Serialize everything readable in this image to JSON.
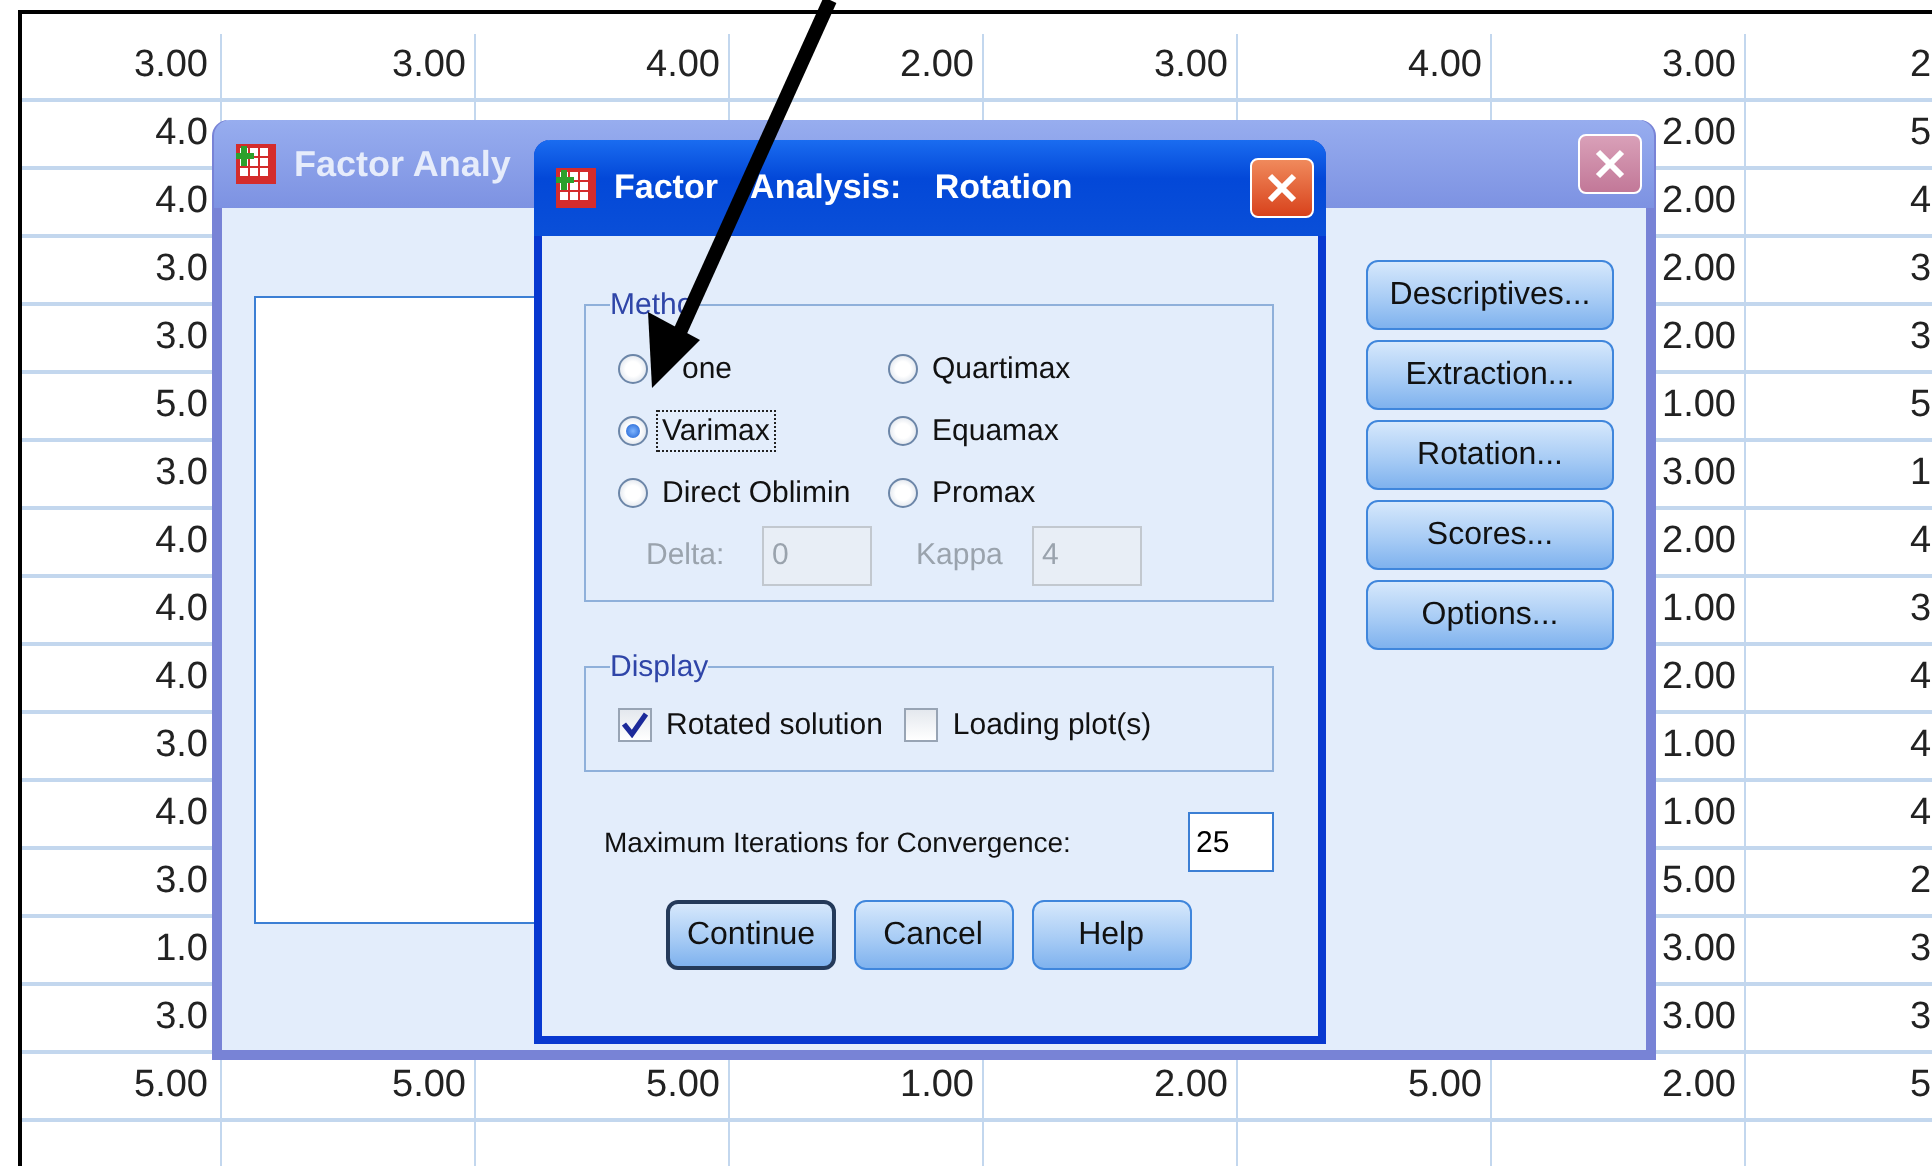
{
  "sheet": {
    "rows": [
      {
        "column_1": "3.00",
        "column_2": "3.00",
        "column_3": "4.00",
        "column_4": "2.00",
        "column_5": "3.00",
        "column_6": "4.00",
        "column_7": "3.00",
        "column_8": "2"
      },
      {
        "column_1": "4.0",
        "column_7": "2.00",
        "column_8": "5"
      },
      {
        "column_1": "4.0",
        "column_7": "2.00",
        "column_8": "4"
      },
      {
        "column_1": "3.0",
        "column_7": "2.00",
        "column_8": "3"
      },
      {
        "column_1": "3.0",
        "column_7": "2.00",
        "column_8": "3"
      },
      {
        "column_1": "5.0",
        "column_7": "1.00",
        "column_8": "5"
      },
      {
        "column_1": "3.0",
        "column_7": "3.00",
        "column_8": "1"
      },
      {
        "column_1": "4.0",
        "column_7": "2.00",
        "column_8": "4"
      },
      {
        "column_1": "4.0",
        "column_7": "1.00",
        "column_8": "3"
      },
      {
        "column_1": "4.0",
        "column_7": "2.00",
        "column_8": "4"
      },
      {
        "column_1": "3.0",
        "column_7": "1.00",
        "column_8": "4"
      },
      {
        "column_1": "4.0",
        "column_7": "1.00",
        "column_8": "4"
      },
      {
        "column_1": "3.0",
        "column_7": "5.00",
        "column_8": "2"
      },
      {
        "column_1": "1.0",
        "column_7": "3.00",
        "column_8": "3"
      },
      {
        "column_1": "3.0",
        "column_7": "3.00",
        "column_8": "3"
      },
      {
        "column_1": "5.00",
        "column_2": "5.00",
        "column_3": "5.00",
        "column_4": "1.00",
        "column_5": "2.00",
        "column_6": "5.00",
        "column_7": "2.00",
        "column_8": "5"
      }
    ]
  },
  "main_dialog": {
    "title": "Factor Analy",
    "buttons": [
      "Descriptives...",
      "Extraction...",
      "Rotation...",
      "Scores...",
      "Options..."
    ]
  },
  "rotation_dialog": {
    "title": "Factor Analysis: Rotation",
    "method": {
      "legend": "Metho",
      "options": [
        {
          "label": "one",
          "selected": false,
          "focused": false
        },
        {
          "label": "Quartimax",
          "selected": false,
          "focused": false
        },
        {
          "label": "Varimax",
          "selected": true,
          "focused": true
        },
        {
          "label": "Equamax",
          "selected": false,
          "focused": false
        },
        {
          "label": "Direct Oblimin",
          "selected": false,
          "focused": false
        },
        {
          "label": "Promax",
          "selected": false,
          "focused": false
        }
      ],
      "params": [
        {
          "label": "Delta:",
          "value": "0",
          "disabled": true
        },
        {
          "label": "Kappa",
          "value": "4",
          "disabled": true
        }
      ]
    },
    "display": {
      "legend": "Display",
      "options": [
        {
          "label": "Rotated solution",
          "checked": true
        },
        {
          "label": "Loading plot(s)",
          "checked": false
        }
      ]
    },
    "iterations": {
      "label": "Maximum Iterations for Convergence:",
      "value": "25"
    },
    "buttons": [
      {
        "label": "Continue",
        "default": true
      },
      {
        "label": "Cancel",
        "default": false
      },
      {
        "label": "Help",
        "default": false
      }
    ]
  }
}
